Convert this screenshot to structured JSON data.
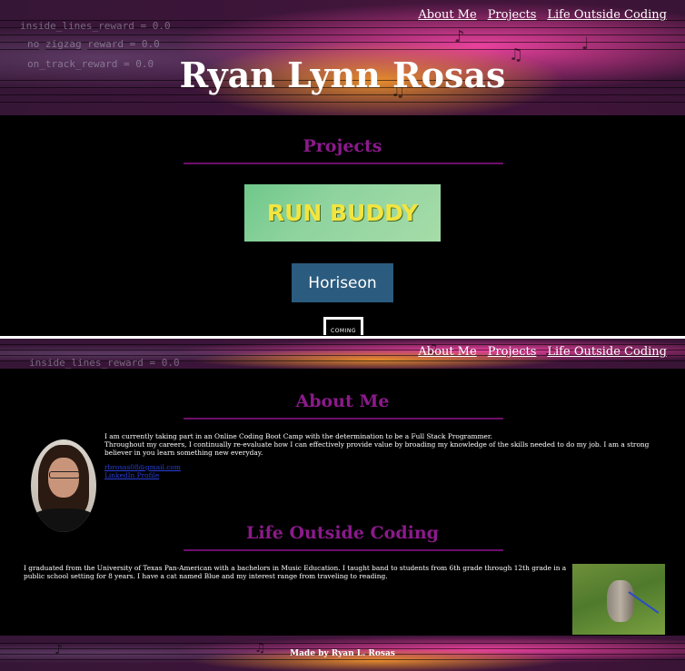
{
  "top": {
    "nav": [
      "About Me",
      "Projects",
      "Life Outside Coding"
    ],
    "hero_title": "Ryan Lynn Rosas",
    "background_code_lines": [
      "inside_lines_reward = 0.0",
      "no_zigzag_reward = 0.0",
      "on_track_reward = 0.0"
    ]
  },
  "projects": {
    "title": "Projects",
    "items": [
      {
        "label": "RUN BUDDY"
      },
      {
        "label": "Horiseon"
      },
      {
        "label": "COMING"
      }
    ]
  },
  "bottom": {
    "nav": [
      "About Me",
      "Projects",
      "Life Outside Coding"
    ],
    "background_code_lines": [
      "inside_lines_reward = 0.0"
    ]
  },
  "about": {
    "title": "About Me",
    "para1": "I am currently taking part in an Online Coding Boot Camp with the determination to be a Full Stack Programmer.",
    "para2": "Throughout my careers, I continually re-evaluate how I can effectively provide value by broading my knowledge of the skills needed to do my job. I am a strong believer in you learn something new everyday.",
    "link1": "rbrosas08@gmail.com",
    "link2": "LinkedIn Profile"
  },
  "life": {
    "title": "Life Outside Coding",
    "text": "I graduated from the University of Texas Pan-American with a bachelors in Music Education. I taught band to students from 6th grade through 12th grade in a public school setting for 8 years. I have a cat named Blue and my interest range from traveling to reading."
  },
  "footer": {
    "text": "Made by Ryan L. Rosas"
  }
}
